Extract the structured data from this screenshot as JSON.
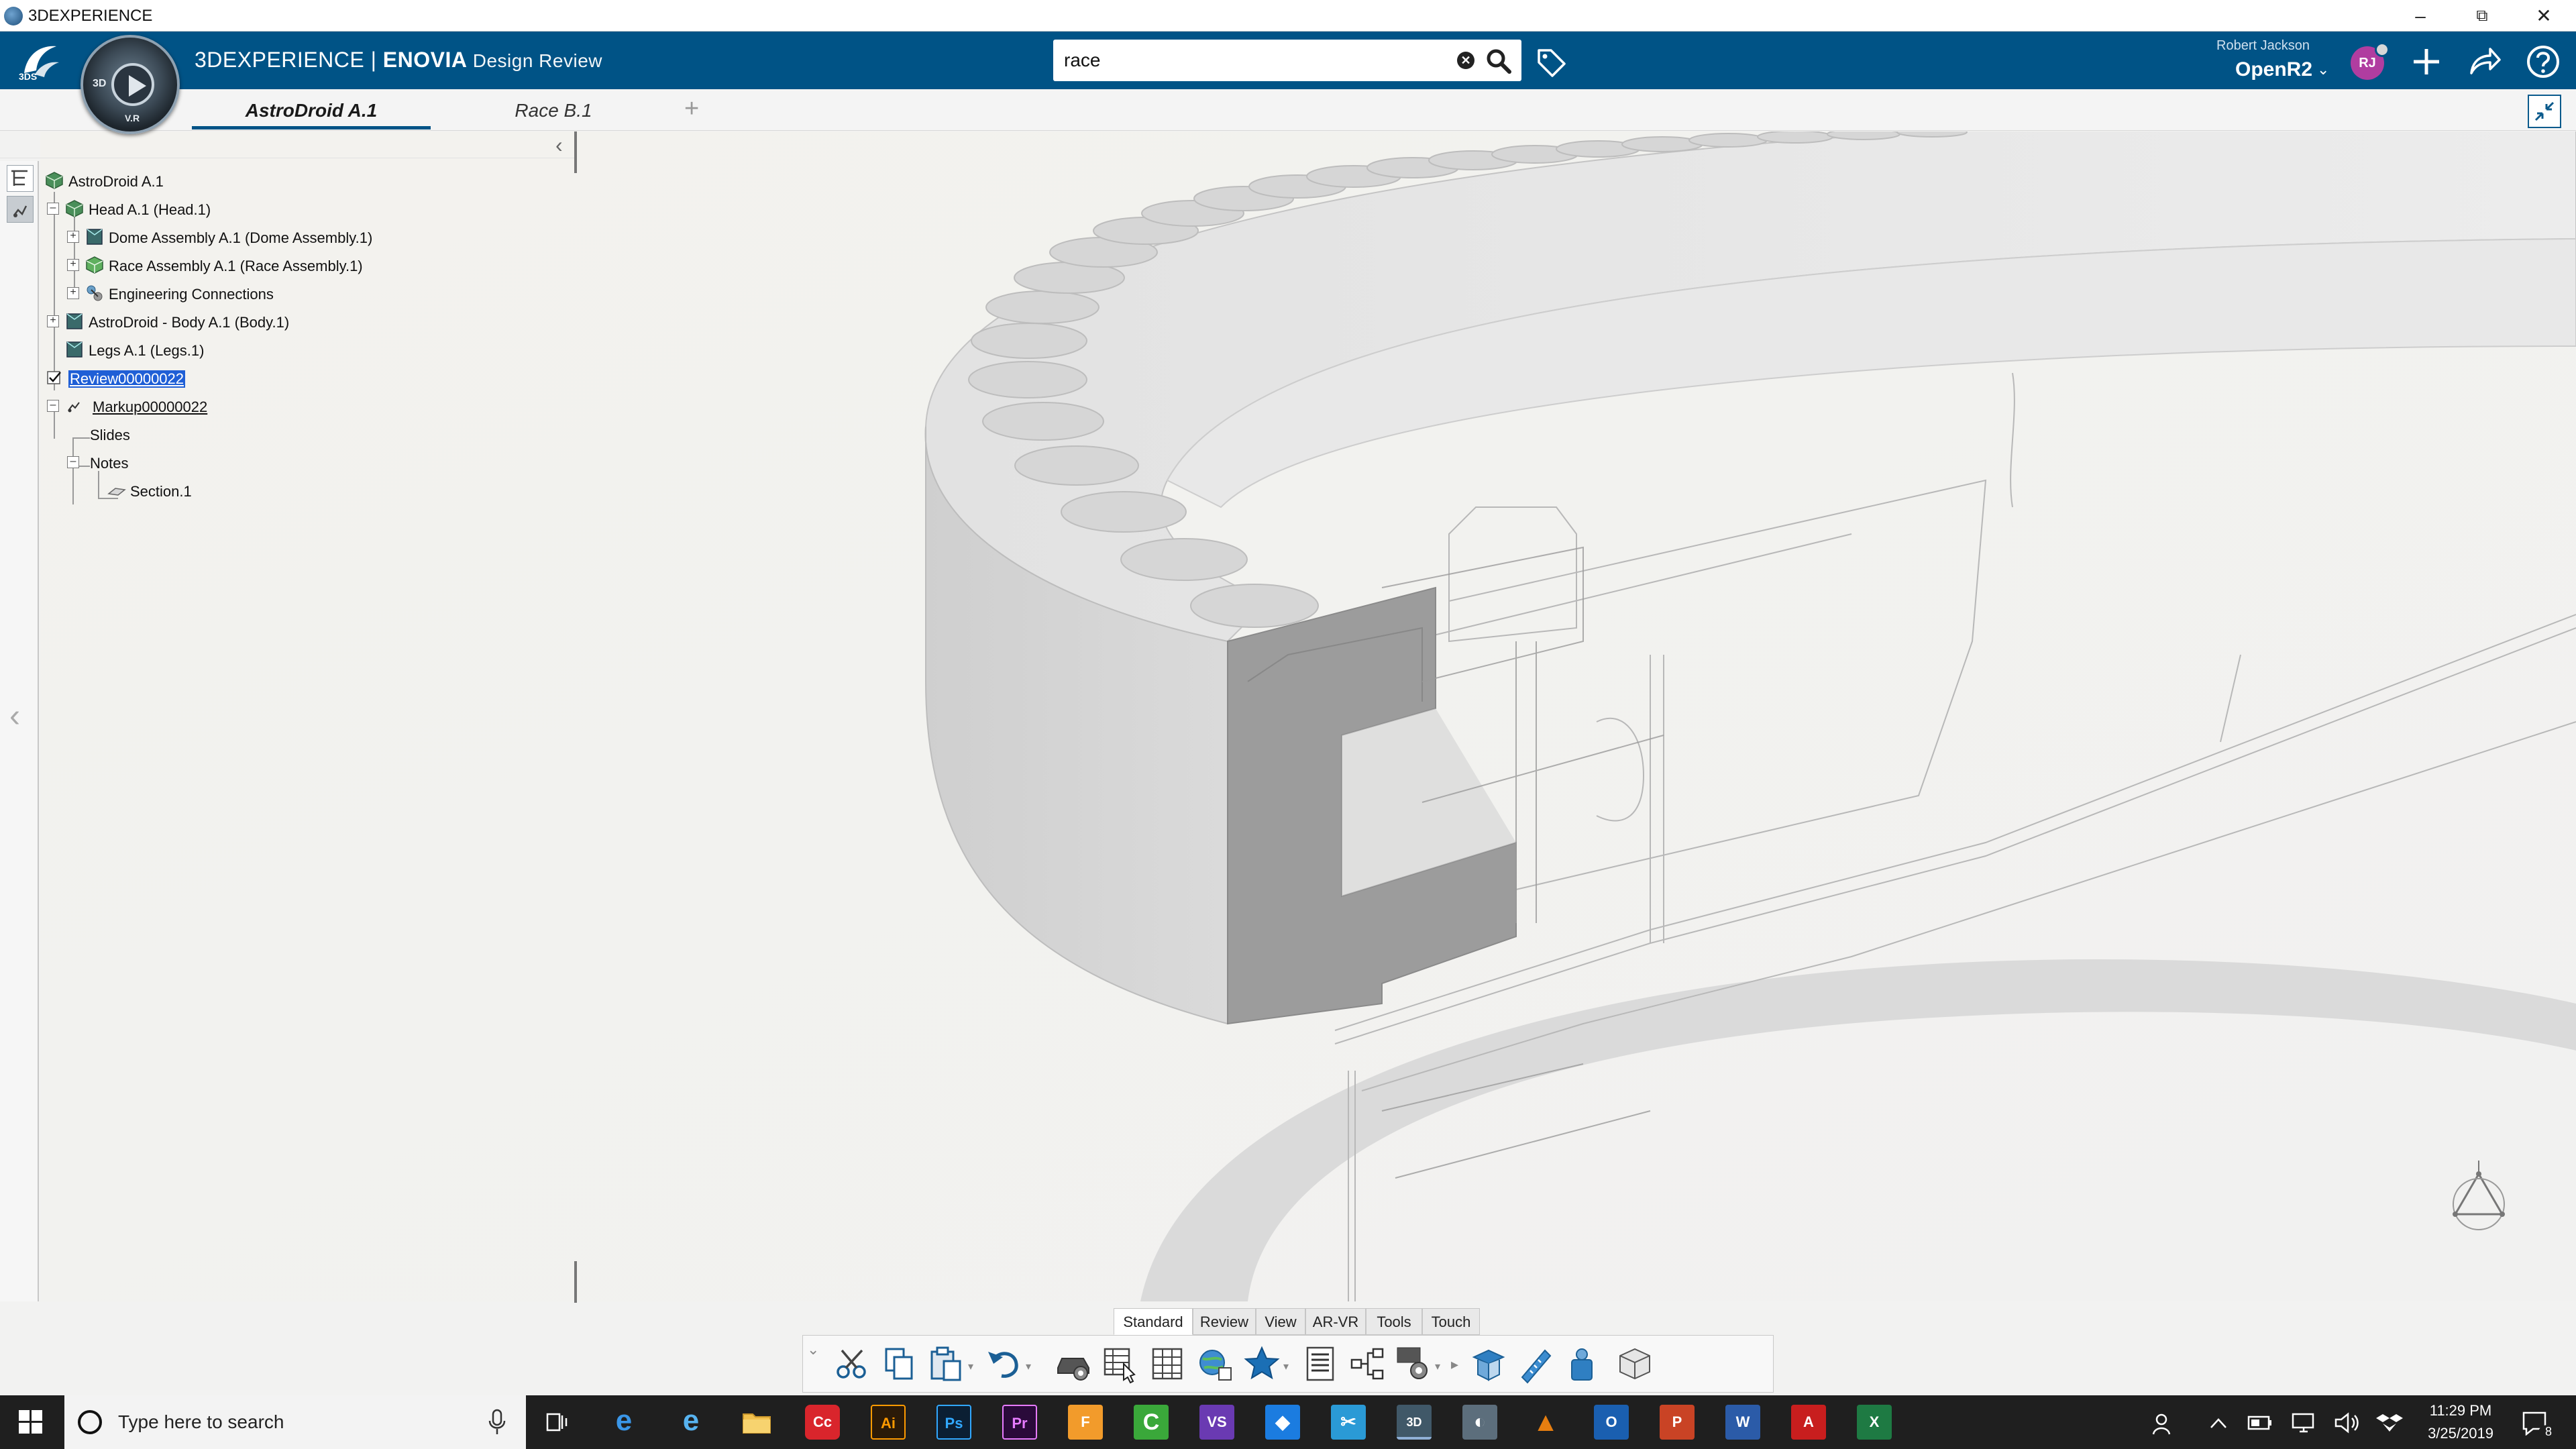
{
  "os_window": {
    "title": "3DEXPERIENCE",
    "minimize": "–",
    "restore": "⧉",
    "close": "✕"
  },
  "header": {
    "brand_main": "3DEXPERIENCE",
    "brand_sep": " | ",
    "brand_app": "ENOVIA",
    "brand_role": " Design Review",
    "compass_3d": "3D",
    "compass_v": "V.R",
    "search": {
      "value": "race",
      "clear_glyph": "✕"
    },
    "user_name": "Robert Jackson",
    "tenant": "OpenR2",
    "tenant_chevron": "⌄",
    "avatar_initials": "RJ",
    "accent_color": "#005386"
  },
  "tabs": [
    {
      "label": "AstroDroid A.1",
      "active": true
    },
    {
      "label": "Race B.1",
      "active": false
    }
  ],
  "tab_add": "+",
  "tree": {
    "collapse_chevron": "‹",
    "expander_plus": "+",
    "expander_minus": "–",
    "items": [
      {
        "label": "AstroDroid A.1"
      },
      {
        "label": "Head A.1 (Head.1)"
      },
      {
        "label": "Dome Assembly A.1 (Dome Assembly.1)"
      },
      {
        "label": "Race Assembly A.1 (Race Assembly.1)"
      },
      {
        "label": "Engineering Connections"
      },
      {
        "label": "AstroDroid - Body A.1 (Body.1)"
      },
      {
        "label": "Legs A.1 (Legs.1)"
      },
      {
        "label": "Review00000022"
      },
      {
        "label": "Markup00000022"
      },
      {
        "label": "Slides"
      },
      {
        "label": "Notes"
      },
      {
        "label": "Section.1"
      }
    ]
  },
  "side_strip": {
    "collapse_glyph": "‹"
  },
  "toolbar": {
    "tabs": [
      {
        "label": "Standard",
        "active": true
      },
      {
        "label": "Review",
        "active": false
      },
      {
        "label": "View",
        "active": false
      },
      {
        "label": "AR-VR",
        "active": false
      },
      {
        "label": "Tools",
        "active": false
      },
      {
        "label": "Touch",
        "active": false
      }
    ],
    "collapse_glyph": "⌄",
    "dropdown_glyph": "▾",
    "more_glyph": "▸"
  },
  "taskbar": {
    "search_placeholder": "Type here to search",
    "apps": [
      {
        "name": "task-view",
        "text": ""
      },
      {
        "name": "edge",
        "text": "e",
        "color": "#1e73c8"
      },
      {
        "name": "internet-explorer",
        "text": "e",
        "color": "#2a8fd8"
      },
      {
        "name": "file-explorer",
        "text": "",
        "color": "#e8b83e"
      },
      {
        "name": "creative-cloud",
        "text": "Cc",
        "color": "#d9252c"
      },
      {
        "name": "illustrator",
        "text": "Ai",
        "color": "#2b1a08"
      },
      {
        "name": "photoshop",
        "text": "Ps",
        "color": "#0b1f33"
      },
      {
        "name": "premiere",
        "text": "Pr",
        "color": "#2a0a3a"
      },
      {
        "name": "fusion",
        "text": "F",
        "color": "#f29b2b"
      },
      {
        "name": "camtasia",
        "text": "C",
        "color": "#3aa83a"
      },
      {
        "name": "visual-studio",
        "text": "VS",
        "color": "#6a3ab2"
      },
      {
        "name": "dropbox",
        "text": "◆",
        "color": "#1b7ce0"
      },
      {
        "name": "snipping-tool",
        "text": "✂",
        "color": "#2a9ad6"
      },
      {
        "name": "3dexperience",
        "text": "3D",
        "color": "#405868",
        "running": true
      },
      {
        "name": "paint",
        "text": "◐",
        "color": "#5c6e7c"
      },
      {
        "name": "vlc",
        "text": "▲",
        "color": "#e67e10"
      },
      {
        "name": "outlook",
        "text": "O",
        "color": "#1a5fb0"
      },
      {
        "name": "powerpoint",
        "text": "P",
        "color": "#c94325"
      },
      {
        "name": "word",
        "text": "W",
        "color": "#2b5ba8"
      },
      {
        "name": "acrobat",
        "text": "A",
        "color": "#c81e1e"
      },
      {
        "name": "excel",
        "text": "X",
        "color": "#1e7a43"
      }
    ],
    "time": "11:29 PM",
    "date": "3/25/2019",
    "notification_count": "8"
  }
}
